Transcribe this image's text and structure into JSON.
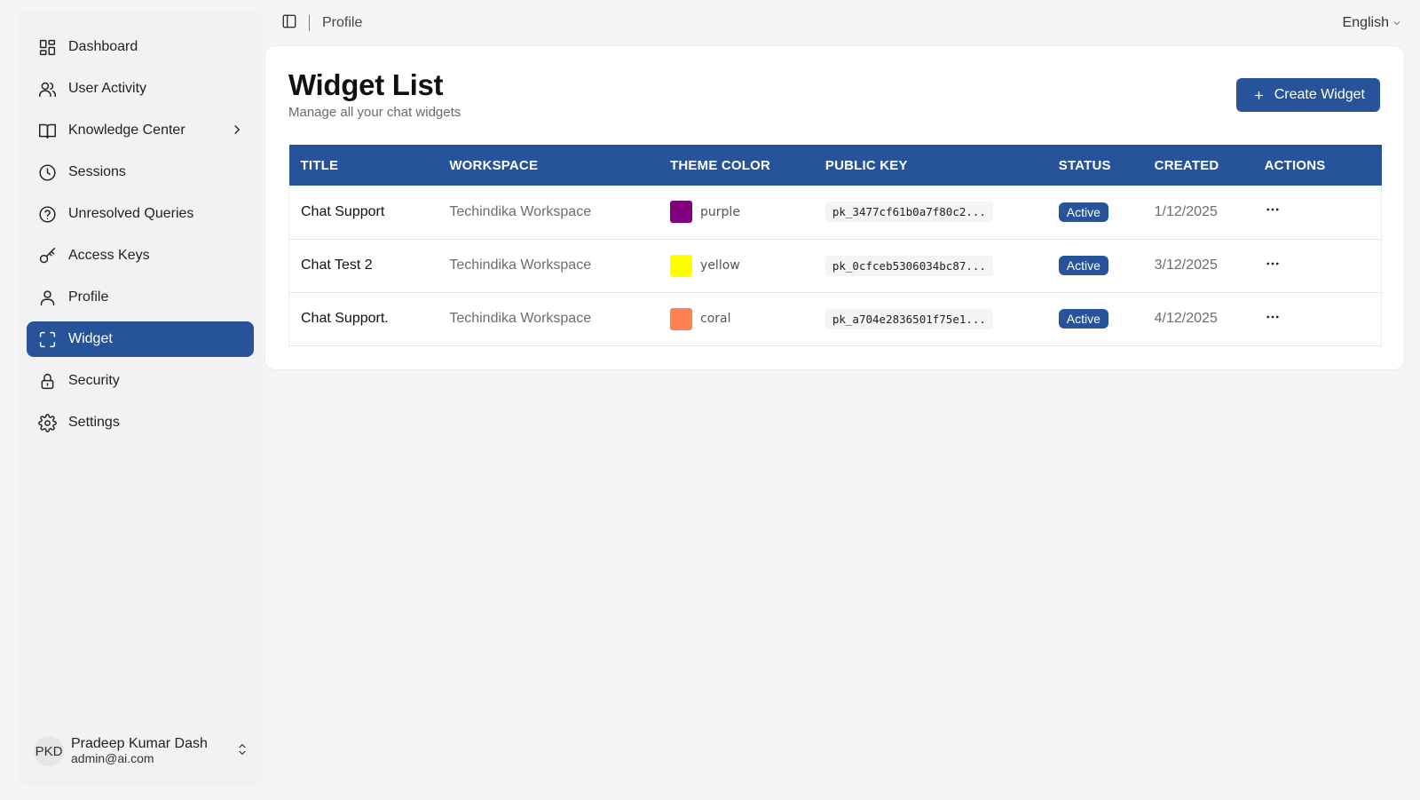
{
  "sidebar": {
    "items": [
      {
        "label": "Dashboard",
        "icon": "dashboard-icon"
      },
      {
        "label": "User Activity",
        "icon": "users-icon"
      },
      {
        "label": "Knowledge Center",
        "icon": "book-icon"
      },
      {
        "label": "Sessions",
        "icon": "clock-icon"
      },
      {
        "label": "Unresolved Queries",
        "icon": "help-circle-icon"
      },
      {
        "label": "Access Keys",
        "icon": "key-icon"
      },
      {
        "label": "Profile",
        "icon": "user-icon"
      },
      {
        "label": "Widget",
        "icon": "scan-icon"
      },
      {
        "label": "Security",
        "icon": "lock-icon"
      },
      {
        "label": "Settings",
        "icon": "gear-icon"
      }
    ],
    "active": "Widget",
    "user": {
      "initials": "PKD",
      "name": "Pradeep Kumar Dash",
      "email": "admin@ai.com"
    }
  },
  "topbar": {
    "breadcrumb": "Profile",
    "language": "English"
  },
  "page": {
    "title": "Widget List",
    "subtitle": "Manage all your chat widgets",
    "create_label": "Create Widget",
    "accent": "#27539a"
  },
  "table": {
    "headers": [
      "TITLE",
      "WORKSPACE",
      "THEME COLOR",
      "PUBLIC KEY",
      "STATUS",
      "CREATED",
      "ACTIONS"
    ],
    "rows": [
      {
        "title": "Chat Support",
        "workspace": "Techindika Workspace",
        "color_name": "purple",
        "color": "#800080",
        "key": "pk_3477cf61b0a7f80c2...",
        "status": "Active",
        "created": "1/12/2025"
      },
      {
        "title": "Chat Test 2",
        "workspace": "Techindika Workspace",
        "color_name": "yellow",
        "color": "#ffff00",
        "key": "pk_0cfceb5306034bc87...",
        "status": "Active",
        "created": "3/12/2025"
      },
      {
        "title": "Chat Support.",
        "workspace": "Techindika Workspace",
        "color_name": "coral",
        "color": "#ff7f50",
        "key": "pk_a704e2836501f75e1...",
        "status": "Active",
        "created": "4/12/2025"
      }
    ]
  }
}
